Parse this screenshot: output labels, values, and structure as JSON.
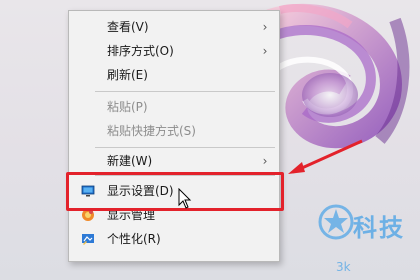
{
  "menu": {
    "items": [
      {
        "label": "查看(V)",
        "submenu": true,
        "disabled": false
      },
      {
        "label": "排序方式(O)",
        "submenu": true,
        "disabled": false
      },
      {
        "label": "刷新(E)",
        "submenu": false,
        "disabled": false
      },
      {
        "label": "粘贴(P)",
        "submenu": false,
        "disabled": true
      },
      {
        "label": "粘贴快捷方式(S)",
        "submenu": false,
        "disabled": true
      },
      {
        "label": "新建(W)",
        "submenu": true,
        "disabled": false
      },
      {
        "label": "显示设置(D)",
        "submenu": false,
        "disabled": false,
        "icon": "display-icon"
      },
      {
        "label": "显示管理",
        "submenu": false,
        "disabled": false,
        "icon": "manage-icon"
      },
      {
        "label": "个性化(R)",
        "submenu": false,
        "disabled": false,
        "icon": "personalize-icon"
      }
    ],
    "chevron": "›"
  },
  "annotation": {
    "color": "#e3222b"
  },
  "watermark": {
    "text": "科技",
    "subtext": "3k",
    "color": "#5aa9e6"
  }
}
